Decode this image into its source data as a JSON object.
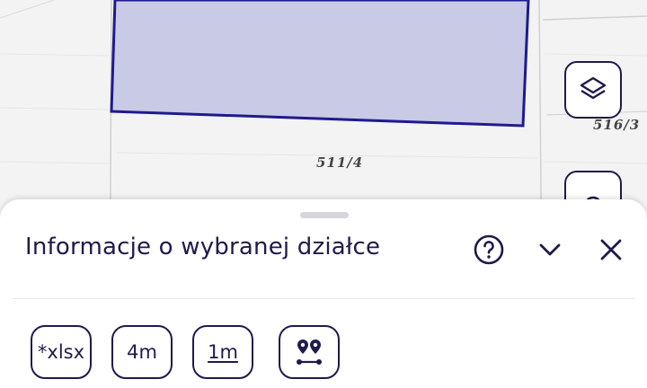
{
  "map": {
    "parcels": [
      {
        "label": "511/4"
      },
      {
        "label": "516/3"
      }
    ],
    "selection_color": "#1f1a8f",
    "selection_fill": "#c9cae6"
  },
  "buttons": {
    "layers_icon": "layers-icon",
    "locate_icon": "locate-icon"
  },
  "sheet": {
    "title": "Informacje o wybranej działce",
    "help_icon": "help-icon",
    "collapse_icon": "chevron-down-icon",
    "close_icon": "close-icon",
    "actions": [
      {
        "label": "*xlsx"
      },
      {
        "label": "4m"
      },
      {
        "label": "1m"
      },
      {
        "label": "",
        "icon": "route-pins-icon"
      }
    ]
  },
  "colors": {
    "accent": "#1f1a4d"
  }
}
